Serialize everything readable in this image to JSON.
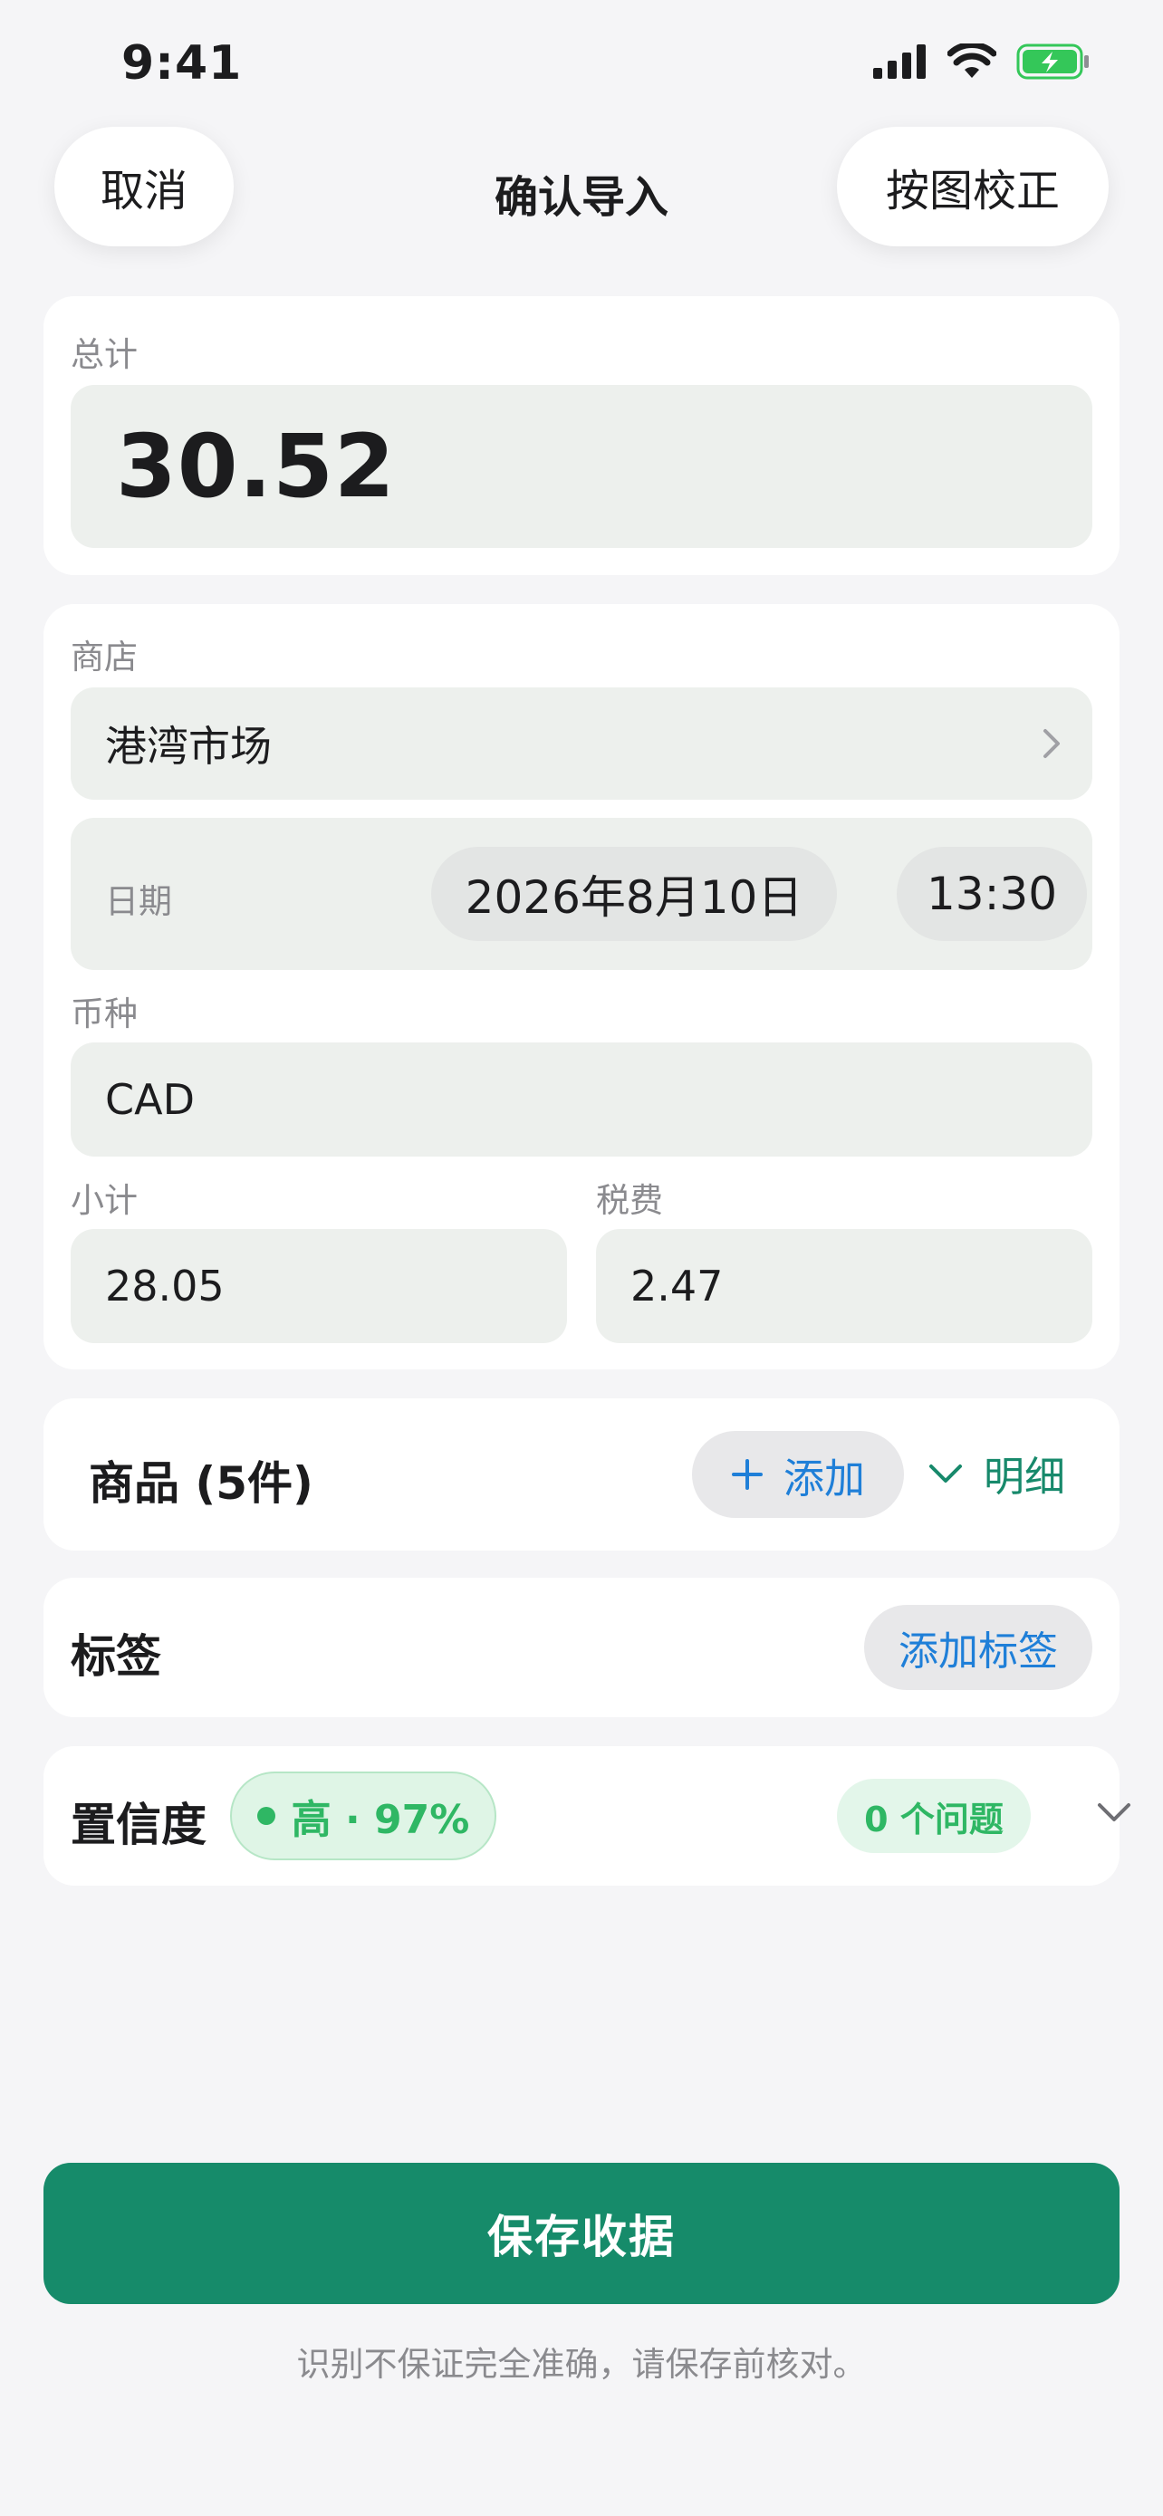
{
  "status_bar": {
    "time": "9:41"
  },
  "nav": {
    "cancel_label": "取消",
    "title": "确认导入",
    "correct_label": "按图校正"
  },
  "total": {
    "label": "总计",
    "value": "30.52"
  },
  "form": {
    "store_label": "商店",
    "store_value": "港湾市场",
    "date_label": "日期",
    "date_value": "2026年8月10日",
    "time_value": "13:30",
    "currency_label": "币种",
    "currency_value": "CAD",
    "subtotal_label": "小计",
    "subtotal_value": "28.05",
    "tax_label": "税费",
    "tax_value": "2.47"
  },
  "items": {
    "title": "商品 (5件)",
    "add_label": "添加",
    "detail_label": "明细"
  },
  "tags": {
    "title": "标签",
    "add_label": "添加标签"
  },
  "confidence": {
    "title": "置信度",
    "level_label": "高 · 97%",
    "issues_label": "0 个问题"
  },
  "footer": {
    "save_label": "保存收据",
    "disclaimer": "识别不保证完全准确，请保存前核对。"
  },
  "colors": {
    "accent_green": "#168b6a",
    "link_blue": "#1f7fd8",
    "success_green": "#2fb764",
    "field_bg": "#edf0ed"
  },
  "icons": [
    "signal-icon",
    "wifi-icon",
    "battery-icon",
    "chevron-right-icon",
    "plus-icon",
    "chevron-down-icon"
  ]
}
